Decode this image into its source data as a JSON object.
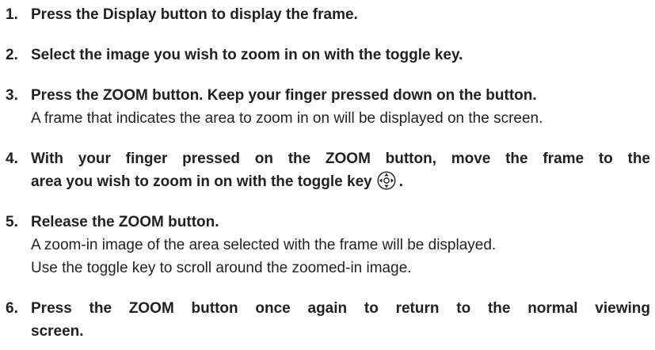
{
  "steps": [
    {
      "number": "1.",
      "lines": [
        "Press the Display button to display the frame."
      ]
    },
    {
      "number": "2.",
      "lines": [
        "Select the image you wish to zoom in on with the toggle key."
      ]
    },
    {
      "number": "3.",
      "lines": [
        "Press the ZOOM button. Keep your finger pressed down on the button."
      ],
      "detail": [
        "A frame that indicates the area to zoom in on will be displayed on the screen."
      ]
    },
    {
      "number": "4.",
      "lines": [
        "With your finger pressed on the ZOOM button, move the frame to the",
        "area you wish to zoom in on with the toggle key",
        "."
      ],
      "icon": "toggle-key-icon"
    },
    {
      "number": "5.",
      "lines": [
        "Release the ZOOM button."
      ],
      "detail": [
        "A zoom-in image of the area selected with the frame will be displayed.",
        "Use the toggle key to scroll around the zoomed-in image."
      ]
    },
    {
      "number": "6.",
      "lines": [
        "Press the ZOOM button once again to return to the normal viewing",
        "screen."
      ]
    }
  ]
}
